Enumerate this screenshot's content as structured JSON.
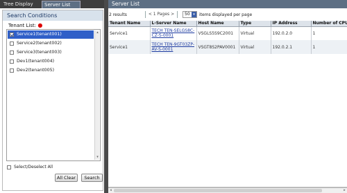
{
  "tabs": [
    {
      "label": "Tree Display"
    },
    {
      "label": "Server List"
    }
  ],
  "conditions": {
    "title": "Search Conditions",
    "tenant_list_label": "Tenant List:",
    "required_mark": "●",
    "tenants": [
      {
        "label": "Service1(tenant001)",
        "checked": true,
        "selected": true
      },
      {
        "label": "Service2(tenant002)",
        "checked": false
      },
      {
        "label": "Service3(tenant003)",
        "checked": false
      },
      {
        "label": "Dev1(tenant004)",
        "checked": false
      },
      {
        "label": "Dev2(tenant005)",
        "checked": false
      }
    ],
    "select_all_label": "Select/Deselect All",
    "clear_button": "All Clear",
    "search_button": "Search"
  },
  "server_list": {
    "title": "Server List",
    "results_text": "2 results",
    "pages_text": "< 1 Pages >",
    "per_page_value": "50",
    "per_page_suffix": "items displayed per page",
    "columns": [
      "Tenant Name",
      "L-Server Name",
      "Host Name",
      "Type",
      "IP Address",
      "Number of CPUs"
    ],
    "rows": [
      {
        "tenant": "Service1",
        "lserver": "TECH TEN-SELGS8C-CZ-S-0001",
        "host": "VSGLS5S9C2001",
        "type": "Virtual",
        "ip": "192.0.2.0",
        "cpus": "1"
      },
      {
        "tenant": "Service1",
        "lserver": "TECH TEN-9GT03ZP-AV-S-0001",
        "host": "VSGT8S2PAV0001",
        "type": "Virtual",
        "ip": "192.0.2.1",
        "cpus": "1"
      }
    ]
  },
  "icons": {
    "scroll_up": "▴",
    "scroll_down": "▾",
    "scroll_left": "◂",
    "scroll_right": "▸",
    "dropdown": "▾"
  }
}
